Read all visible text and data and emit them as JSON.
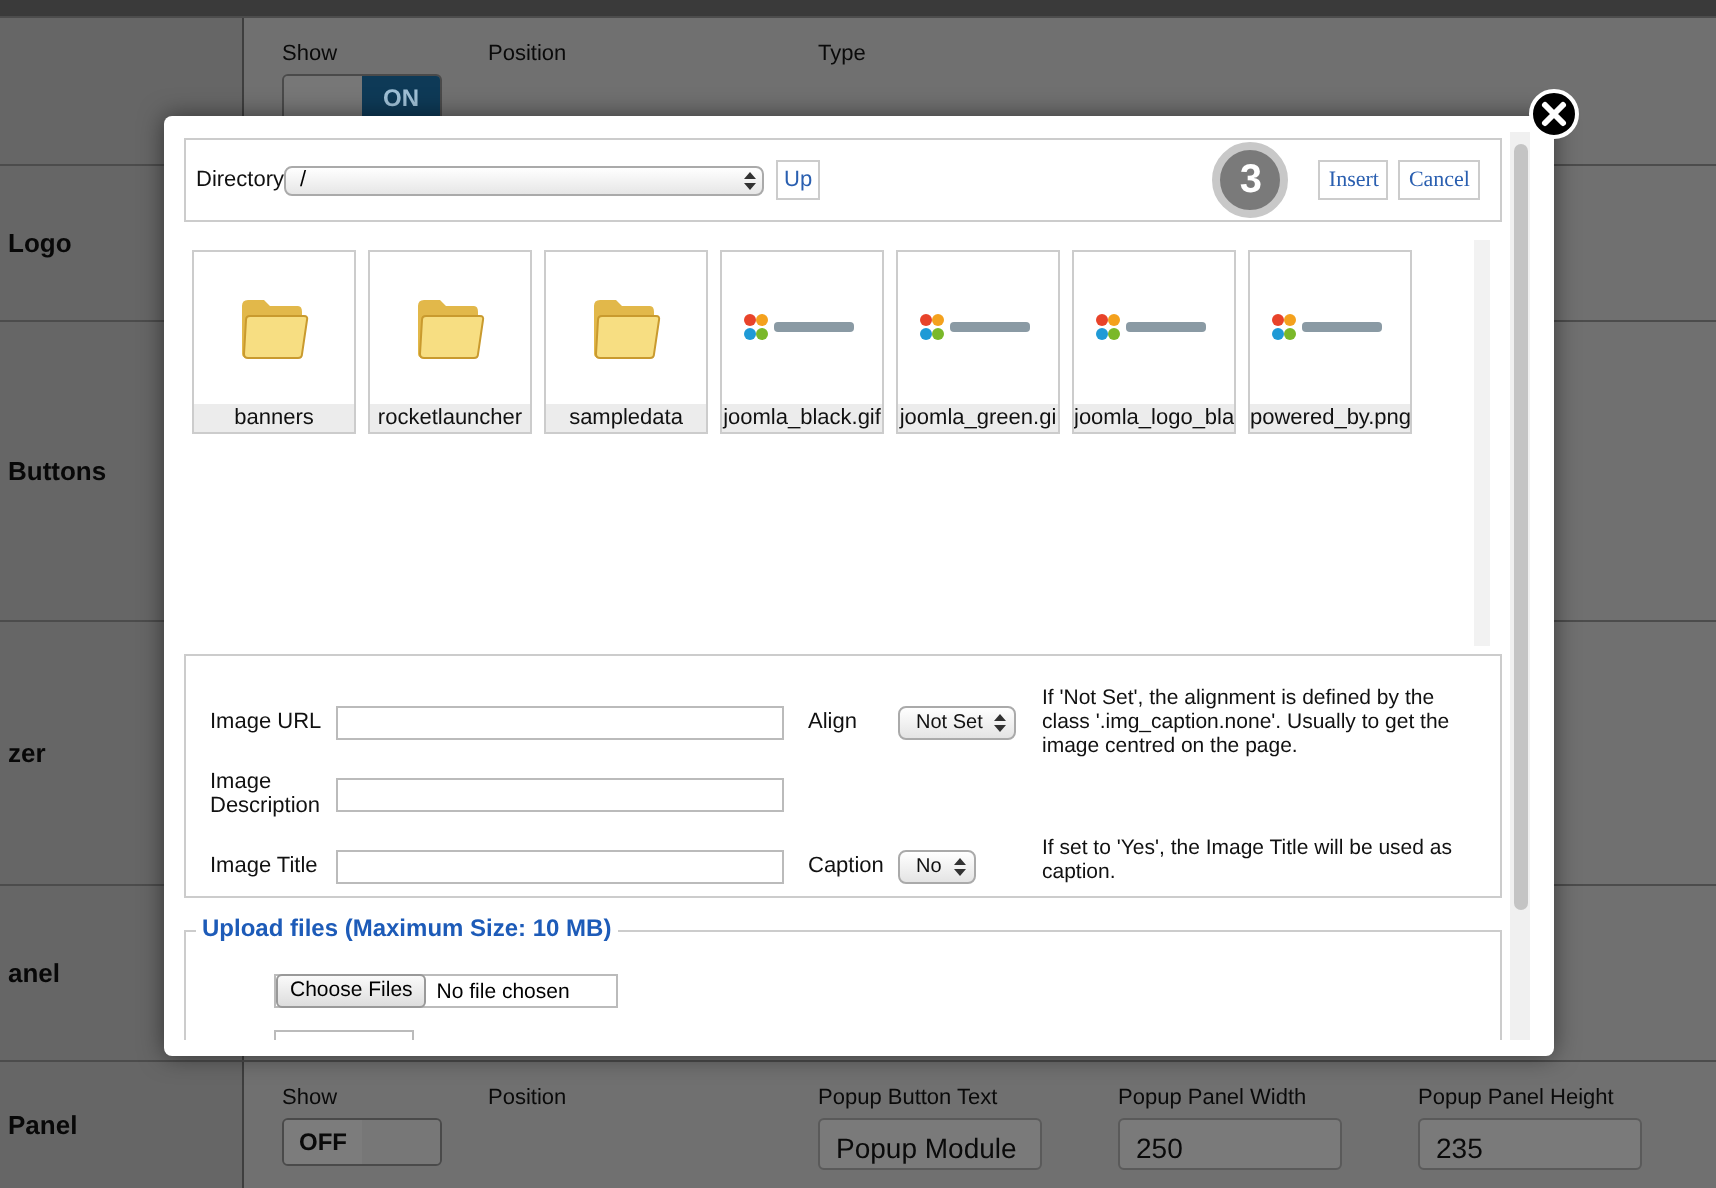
{
  "background": {
    "rows": [
      {
        "label": "",
        "fields": [
          {
            "kind": "toggle",
            "label": "Show",
            "on": true,
            "text": "ON"
          },
          {
            "kind": "label",
            "label": "Position"
          },
          {
            "kind": "label",
            "label": "Type"
          }
        ]
      },
      {
        "label": "Logo",
        "fields": []
      },
      {
        "label": "Buttons",
        "fields": []
      },
      {
        "label": "zer",
        "fields": []
      },
      {
        "label": "anel",
        "fields": []
      },
      {
        "label": "Panel",
        "fields": [
          {
            "kind": "toggle",
            "label": "Show",
            "on": false,
            "text": "OFF"
          },
          {
            "kind": "label",
            "label": "Position"
          },
          {
            "kind": "input",
            "label": "Popup Button Text",
            "value": "Popup Module"
          },
          {
            "kind": "input",
            "label": "Popup Panel Width",
            "value": "250"
          },
          {
            "kind": "input",
            "label": "Popup Panel Height",
            "value": "235"
          }
        ]
      }
    ]
  },
  "modal": {
    "toolbar": {
      "directory_label": "Directory",
      "directory_value": "/",
      "up_button": "Up",
      "step": "3",
      "buttons": [
        "Insert",
        "Cancel"
      ]
    },
    "files": [
      {
        "name": "banners",
        "kind": "folder"
      },
      {
        "name": "rocketlauncher",
        "kind": "folder"
      },
      {
        "name": "sampledata",
        "kind": "folder"
      },
      {
        "name": "joomla_black.gif"
      },
      {
        "name": "joomla_green.gi"
      },
      {
        "name": "joomla_logo_bla"
      },
      {
        "name": "powered_by.png"
      }
    ],
    "form": {
      "fields": [
        {
          "label": "Image URL",
          "option_label": "Align",
          "option_value": "Not Set",
          "help": "If 'Not Set', the alignment is defined by the class '.img_caption.none'. Usually to get the image centred on the page."
        },
        {
          "label": "Image Description"
        },
        {
          "label": "Image Title",
          "option_label": "Caption",
          "option_value": "No",
          "help": "If set to 'Yes', the Image Title will be used as caption."
        }
      ]
    },
    "upload": {
      "legend": "Upload files (Maximum Size: 10 MB)",
      "choose_button": "Choose Files",
      "status": "No file chosen"
    }
  }
}
